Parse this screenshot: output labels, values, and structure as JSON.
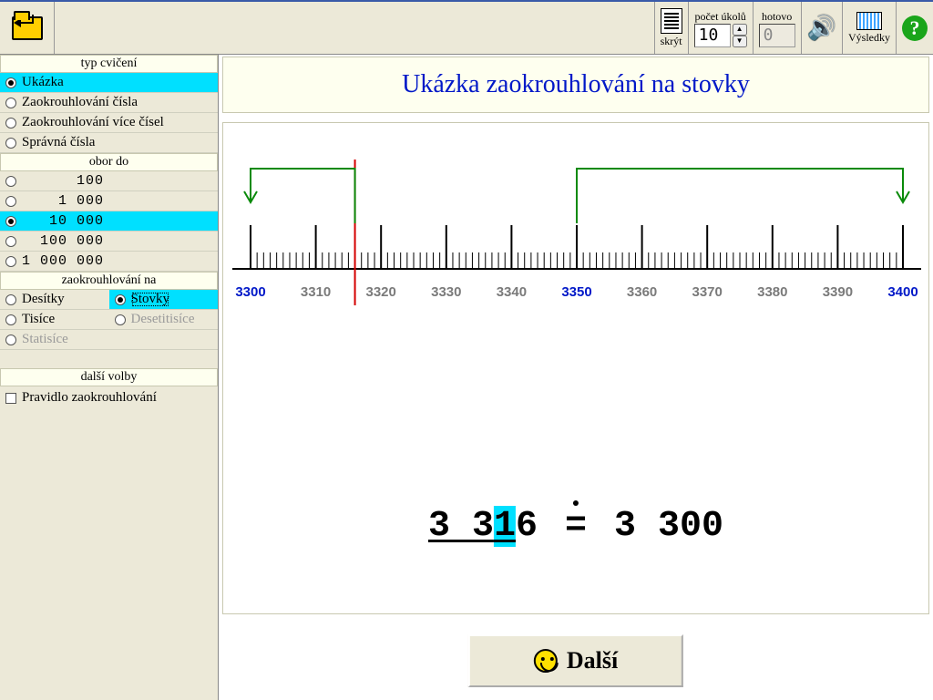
{
  "toolbar": {
    "hide_label": "skrýt",
    "task_count_label": "počet úkolů",
    "task_count_value": "10",
    "done_label": "hotovo",
    "done_value": "0",
    "results_label": "Výsledky"
  },
  "sidebar": {
    "type_title": "typ cvičení",
    "types": [
      {
        "label": "Ukázka",
        "selected": true
      },
      {
        "label": "Zaokrouhlování čísla",
        "selected": false
      },
      {
        "label": "Zaokrouhlování více čísel",
        "selected": false
      },
      {
        "label": "Správná čísla",
        "selected": false
      }
    ],
    "range_title": "obor do",
    "ranges": [
      {
        "label": "      100",
        "selected": false
      },
      {
        "label": "    1 000",
        "selected": false
      },
      {
        "label": "   10 000",
        "selected": true
      },
      {
        "label": "  100 000",
        "selected": false
      },
      {
        "label": "1 000 000",
        "selected": false
      }
    ],
    "round_title": "zaokrouhlování na",
    "round_opts": {
      "r1": {
        "label": "Desítky",
        "disabled": false,
        "selected": false
      },
      "r2": {
        "label": "Stovky",
        "disabled": false,
        "selected": true
      },
      "r3": {
        "label": "Tisíce",
        "disabled": false,
        "selected": false
      },
      "r4": {
        "label": "Desetitisíce",
        "disabled": true,
        "selected": false
      },
      "r5": {
        "label": "Statisíce",
        "disabled": true,
        "selected": false
      }
    },
    "options_title": "další volby",
    "rule_label": "Pravidlo zaokrouhlování"
  },
  "content": {
    "title": "Ukázka zaokrouhlování na stovky",
    "next_label": "Další",
    "equation": {
      "pre": "3 3",
      "hi": "1",
      "post": "6",
      "approx_eq": "=",
      "result": "3 300"
    }
  },
  "chart_data": {
    "type": "number-line",
    "axis_min": 3300,
    "axis_max": 3400,
    "major_tick_step": 10,
    "minor_tick_step": 1,
    "tick_labels": [
      3300,
      3310,
      3320,
      3330,
      3340,
      3350,
      3360,
      3370,
      3380,
      3390,
      3400
    ],
    "highlighted_labels": [
      3300,
      3350,
      3400
    ],
    "value_marker": 3316,
    "rounded_to": 3300,
    "arrows": [
      {
        "from": 3316,
        "to": 3300,
        "color": "#0a8a0a"
      },
      {
        "from": 3350,
        "to": 3400,
        "color": "#0a8a0a"
      }
    ],
    "marker_color": "#d40000"
  }
}
